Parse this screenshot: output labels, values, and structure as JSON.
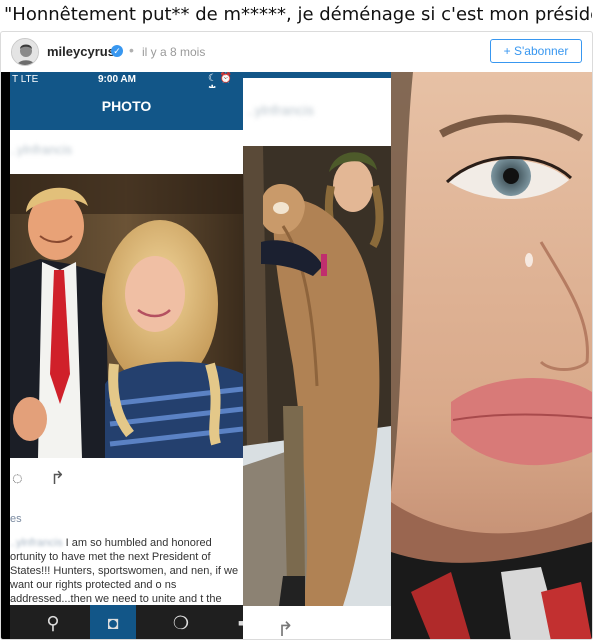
{
  "headline": "\"Honnêtement put** de m*****, je déménage si c'est mon président\"",
  "post": {
    "username": "mileycyrus",
    "verified_icon": "check-badge-icon",
    "separator": "•",
    "time": "il y a 8 mois",
    "follow_label": "+ S'abonner"
  },
  "screenshot1": {
    "carrier": "T  LTE",
    "time": "9:00 AM",
    "indicators": "☾ ⏰ ✱",
    "nav_title": "PHOTO",
    "blurred_user": "..ylnfrancis",
    "caption_likes": "es",
    "caption_user": "..ylnfrancis",
    "caption_text": " I am so humbled and honored ortunity to have met the next President of States!!! Hunters, sportswomen, and nen, if we want our rights protected and o ns addressed...then we need to unite and t the man who will make that happen!",
    "action_icons": [
      "comment-icon",
      "share-icon"
    ],
    "bottom_nav": [
      "search-icon",
      "camera-icon",
      "activity-icon",
      "profile-icon"
    ]
  },
  "screenshot2": {
    "blurred_user": "..ylnfrancis",
    "action_icons": [
      "share-icon"
    ]
  },
  "colors": {
    "instagram_blue": "#125688",
    "follow_blue": "#3897f0"
  }
}
